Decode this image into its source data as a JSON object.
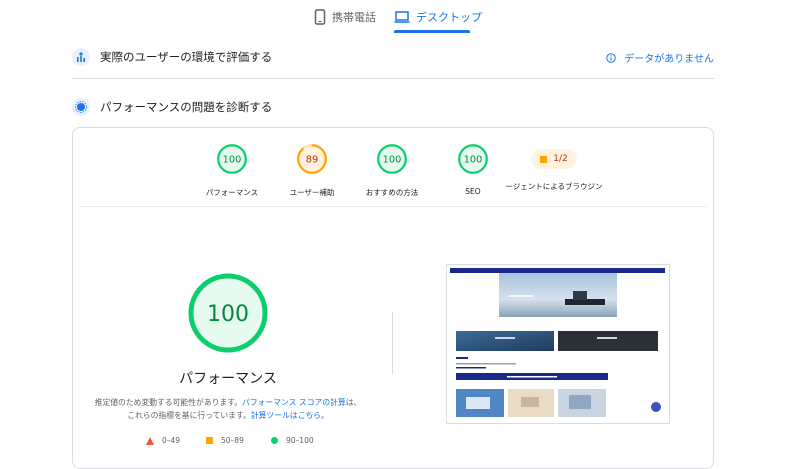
{
  "tabs": [
    {
      "label": "携帯電話",
      "active": false
    },
    {
      "label": "デスクトップ",
      "active": true
    }
  ],
  "field_data": {
    "title": "実際のユーザーの環境で評価する",
    "no_data": "データがありません"
  },
  "diagnose": {
    "title": "パフォーマンスの問題を診断する"
  },
  "categories": [
    {
      "label": "パフォーマンス",
      "score": "100",
      "color": "#0cce6b"
    },
    {
      "label": "ユーザー補助",
      "score": "89",
      "color": "#ffa400"
    },
    {
      "label": "おすすめの方法",
      "score": "100",
      "color": "#0cce6b"
    },
    {
      "label": "SEO",
      "score": "100",
      "color": "#0cce6b"
    },
    {
      "label": "ージェントによるブラウジン",
      "score": "1/2",
      "color": "#ffa400"
    }
  ],
  "main_score": {
    "value": "100",
    "label": "パフォーマンス"
  },
  "description": {
    "text1": "推定値のため変動する可能性があります。",
    "link1": "パフォーマンス スコアの計算",
    "text2": "は、これらの指標を基に行っています。",
    "link2": "計算ツールはこちら。"
  },
  "legend": {
    "fail": "0–49",
    "average": "50–89",
    "pass": "90–100"
  },
  "colors": {
    "accent": "#1a73e8",
    "pass": "#0cce6b",
    "average": "#ffa400",
    "fail": "#ff4e42"
  }
}
